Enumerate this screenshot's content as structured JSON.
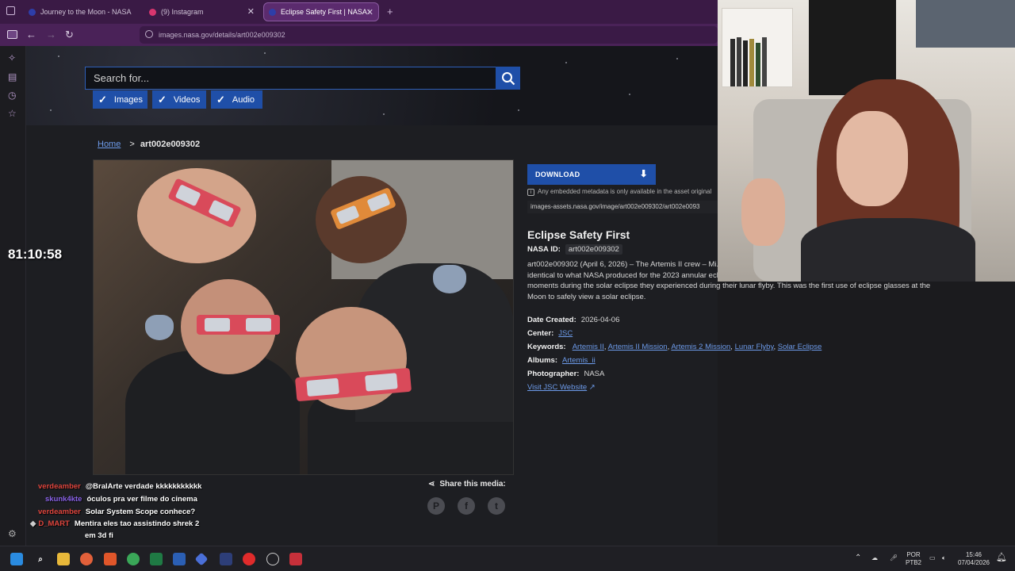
{
  "browser": {
    "tabs": [
      {
        "label": "Journey to the Moon - NASA",
        "favicon_color": "#2e3ea8"
      },
      {
        "label": "(9) Instagram",
        "favicon_color": "#d8366f"
      },
      {
        "label": "Eclipse Safety First | NASA Imag",
        "favicon_color": "#2e3ea8"
      }
    ],
    "url": "images.nasa.gov/details/art002e009302",
    "new_tab": "+"
  },
  "nasa": {
    "search_placeholder": "Search for...",
    "filters": [
      "Images",
      "Videos",
      "Audio"
    ],
    "breadcrumb_home": "Home",
    "breadcrumb_sep": ">",
    "breadcrumb_current": "art002e009302",
    "download_label": "DOWNLOAD",
    "metadata_note": "Any embedded metadata is only available in the asset original",
    "asset_url": "images-assets.nasa.gov/image/art002e009302/art002e0093",
    "title": "Eclipse Safety First",
    "nasa_id_label": "NASA ID:",
    "nasa_id": "art002e009302",
    "description": "art002e009302 (April 6, 2026) – The Artemis II crew – Mi... Hansen (bottom left), Commander Reid Wiseman (bottom... identical to what NASA produced for the 2023 annular eclipse and 2024 total solar eclipse, to protect their eyes at key moments during the solar eclipse they experienced during their lunar flyby. This was the first use of eclipse glasses at the Moon to safely view a solar eclipse.",
    "date_label": "Date Created:",
    "date": "2026-04-06",
    "center_label": "Center:",
    "center": "JSC",
    "keywords_label": "Keywords:",
    "keywords": [
      "Artemis II",
      "Artemis II Mission",
      "Artemis 2 Mission",
      "Lunar Flyby",
      "Solar Eclipse"
    ],
    "albums_label": "Albums:",
    "album": "Artemis_ii",
    "photographer_label": "Photographer:",
    "photographer": "NASA",
    "visit_link": "Visit JSC Website",
    "share_label": "Share this media:",
    "social": [
      "P",
      "f",
      "t"
    ]
  },
  "stream": {
    "timer": "81:10:58",
    "chat": [
      {
        "user": "verdeamber",
        "user_color": "#e0463e",
        "msg": "@BralArte verdade kkkkkkkkkkk"
      },
      {
        "user": "skunk4kte",
        "user_color": "#8a63e8",
        "msg": "óculos pra ver filme do cinema"
      },
      {
        "user": "verdeamber",
        "user_color": "#e0463e",
        "msg": "Solar System Scope conhece?"
      },
      {
        "user": "D_MART",
        "user_color": "#e0463e",
        "msg": "Mentira eles tao assistindo shrek 2"
      },
      {
        "user": "",
        "user_color": "#e0463e",
        "msg": "em 3d fi"
      }
    ]
  },
  "taskbar": {
    "lang_top": "POR",
    "lang_bottom": "PTB2",
    "time": "15:46",
    "date": "07/04/2026"
  }
}
